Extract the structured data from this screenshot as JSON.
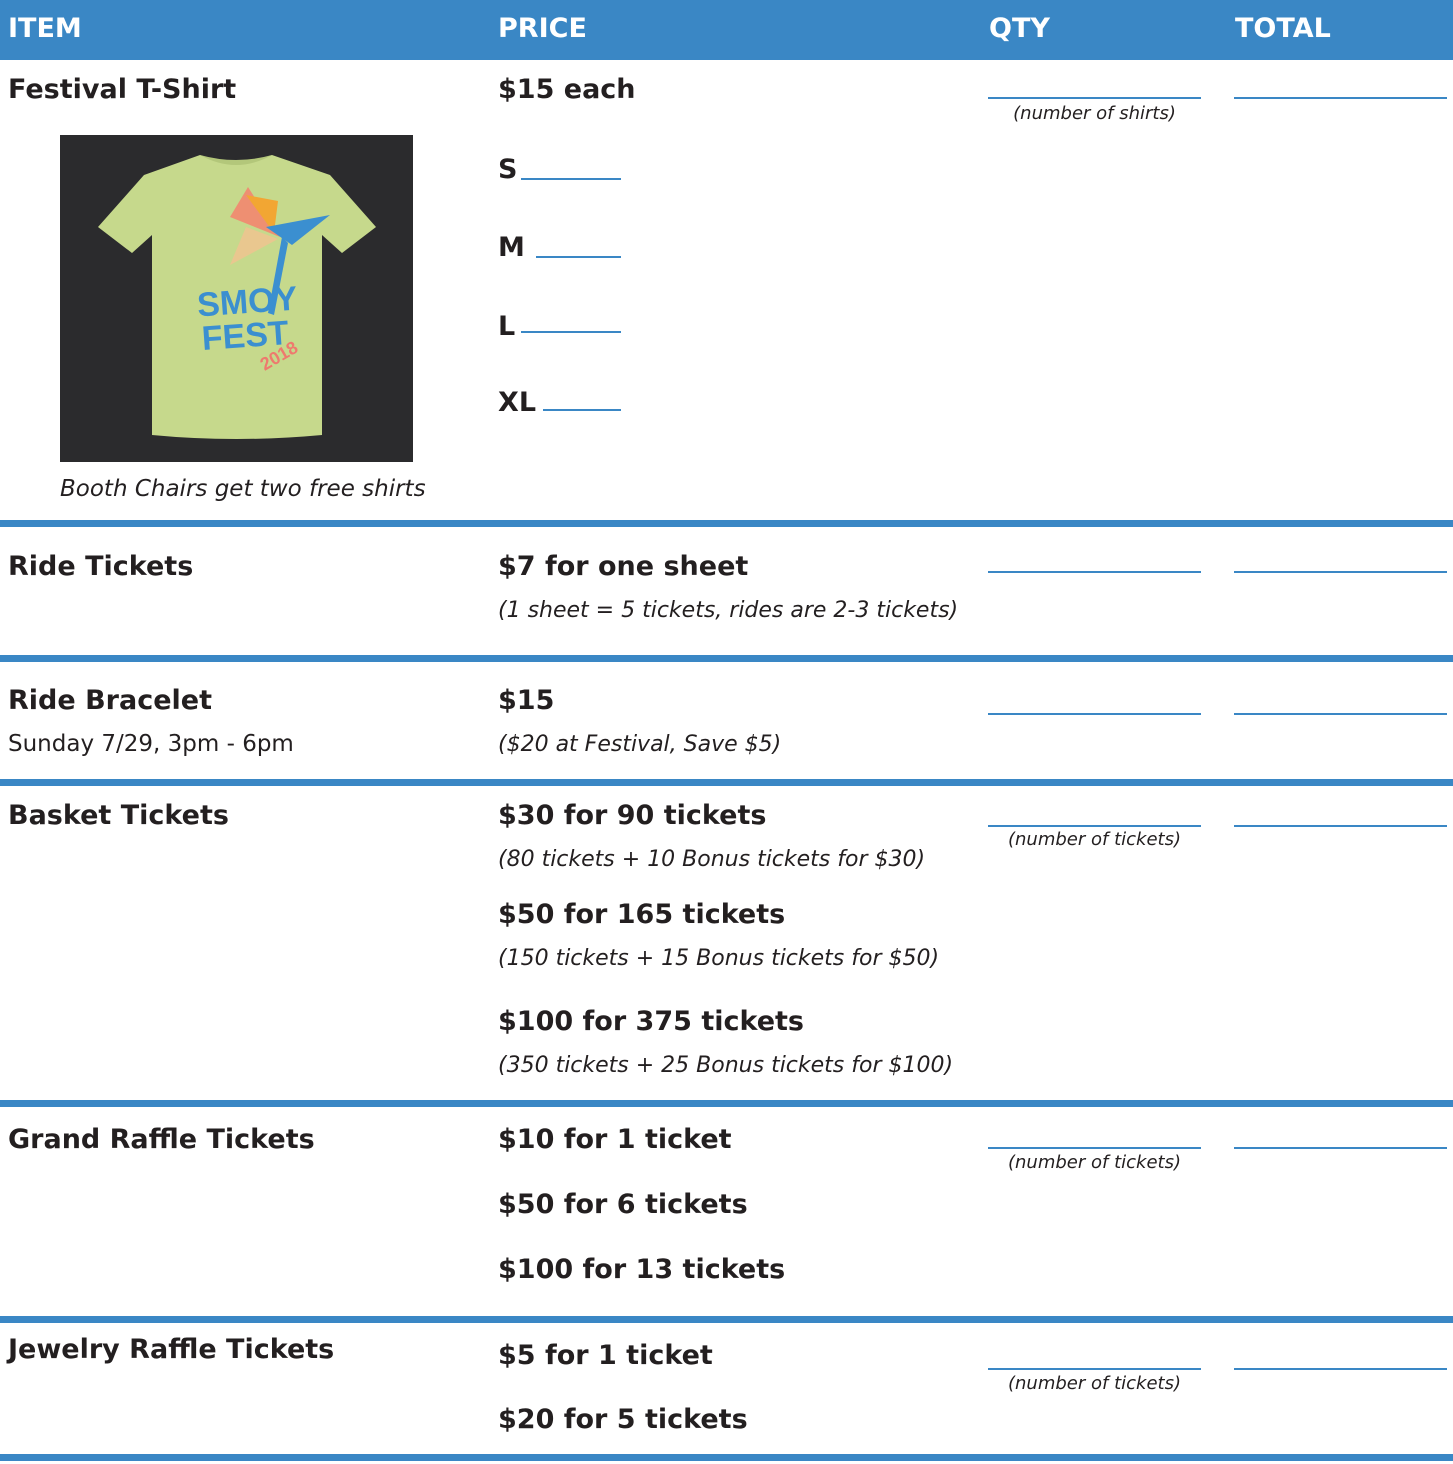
{
  "header": {
    "item": "ITEM",
    "price": "PRICE",
    "qty": "QTY",
    "total": "TOTAL"
  },
  "tshirt": {
    "name": "Festival T-Shirt",
    "price": "$15 each",
    "qty_hint": "(number of shirts)",
    "caption": "Booth Chairs get two free shirts",
    "sizes": [
      "S",
      "M",
      "L",
      "XL"
    ],
    "image": {
      "logo_line1": "SMOY",
      "logo_line2": "FEST",
      "year": "2018"
    }
  },
  "ride_tickets": {
    "name": "Ride Tickets",
    "price": "$7 for one sheet",
    "note": "(1 sheet = 5 tickets, rides are 2-3 tickets)"
  },
  "ride_bracelet": {
    "name": "Ride Bracelet",
    "sub": "Sunday 7/29, 3pm - 6pm",
    "price": "$15",
    "note": "($20 at Festival, Save $5)"
  },
  "basket_tickets": {
    "name": "Basket Tickets",
    "qty_hint": "(number of tickets)",
    "options": [
      {
        "price": "$30 for 90 tickets",
        "note": "(80 tickets + 10 Bonus tickets for $30)"
      },
      {
        "price": "$50 for 165 tickets",
        "note": "(150 tickets + 15 Bonus tickets for $50)"
      },
      {
        "price": "$100 for 375 tickets",
        "note": "(350 tickets + 25 Bonus tickets for $100)"
      }
    ]
  },
  "grand_raffle": {
    "name": "Grand Raffle Tickets",
    "qty_hint": "(number of tickets)",
    "options": [
      "$10 for 1 ticket",
      "$50 for 6 tickets",
      "$100 for 13 tickets"
    ]
  },
  "jewelry_raffle": {
    "name": "Jewelry Raffle Tickets",
    "qty_hint": "(number of tickets)",
    "options": [
      "$5 for 1 ticket",
      "$20 for 5 tickets"
    ]
  },
  "colors": {
    "accent": "#3a87c5",
    "text": "#231f20",
    "shirt": "#c6d98c",
    "shirt_bg": "#2b2b2d"
  }
}
